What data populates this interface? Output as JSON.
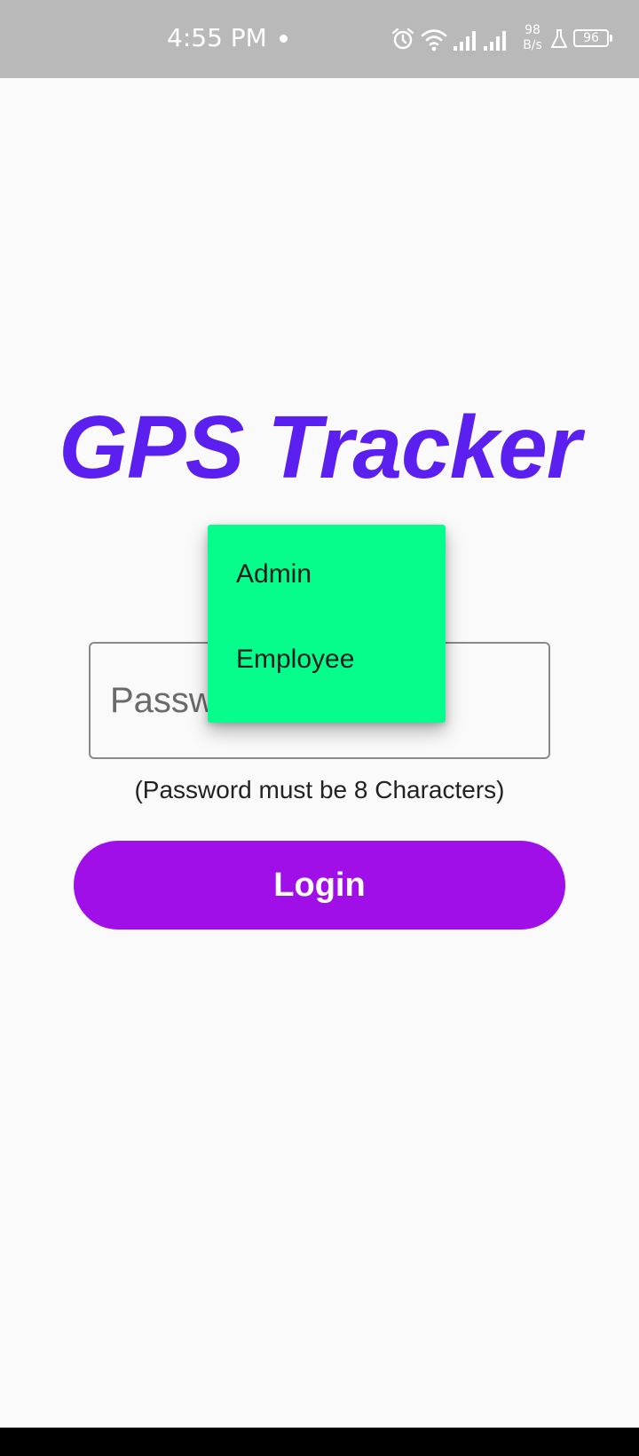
{
  "status_bar": {
    "time": "4:55 PM",
    "net_speed_value": "98",
    "net_speed_unit": "B/s",
    "battery_level": "96",
    "icons": [
      "alarm-icon",
      "wifi-icon",
      "signal-icon",
      "signal-icon",
      "flask-icon",
      "battery-icon"
    ]
  },
  "app": {
    "title": "GPS Tracker"
  },
  "form": {
    "password_placeholder": "Password",
    "password_hint": "(Password must be 8 Characters)",
    "login_label": "Login"
  },
  "dropdown": {
    "options": [
      "Admin",
      "Employee"
    ]
  },
  "colors": {
    "status_bar": "#b9b9b9",
    "title": "#5b1ff0",
    "login_button": "#a10fe8",
    "dropdown_bg": "#07fd8b",
    "background": "#fafafa"
  }
}
